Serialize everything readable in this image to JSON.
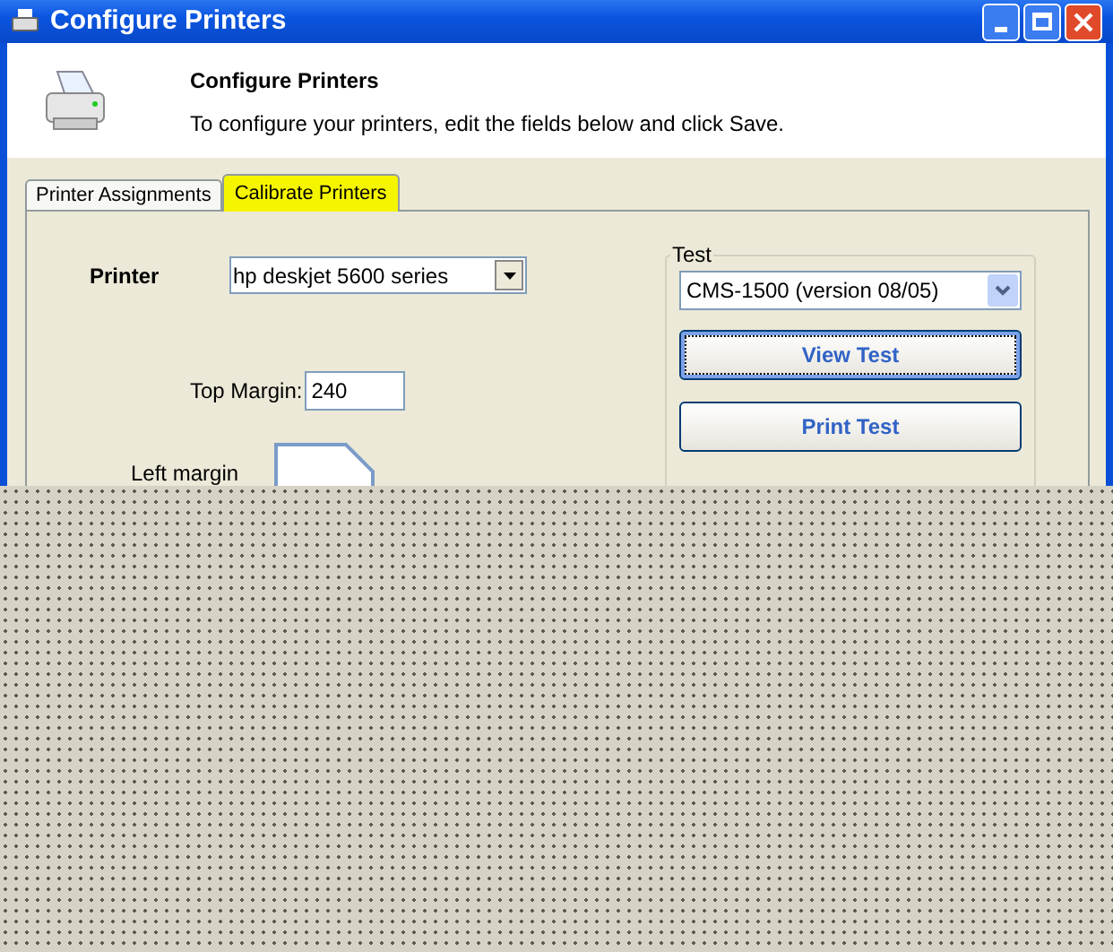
{
  "window": {
    "title": "Configure Printers"
  },
  "header": {
    "title": "Configure Printers",
    "description": "To configure your printers, edit the fields below and click Save."
  },
  "tabs": [
    {
      "label": "Printer Assignments",
      "selected": false
    },
    {
      "label": "Calibrate Printers",
      "selected": true
    }
  ],
  "printer": {
    "label": "Printer",
    "value": "hp deskjet 5600 series"
  },
  "top_margin": {
    "label": "Top Margin:",
    "value": "240"
  },
  "left_margin": {
    "label": "Left margin"
  },
  "test": {
    "title": "Test",
    "value": "CMS-1500 (version 08/05)",
    "buttons": [
      {
        "label": "View Test",
        "focused": true
      },
      {
        "label": "Print Test",
        "focused": false
      }
    ]
  }
}
